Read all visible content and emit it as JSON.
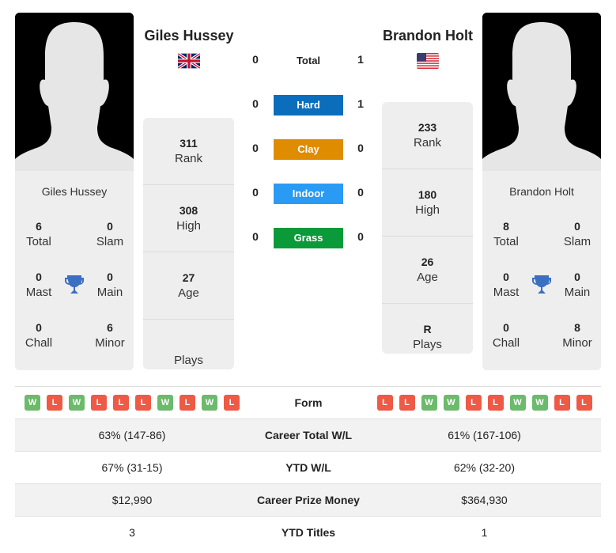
{
  "colors": {
    "hard": "#0a6ebd",
    "clay": "#df8c00",
    "indoor": "#2a9bf5",
    "grass": "#0b9a3a",
    "win": "#6cba6c",
    "loss": "#ee5a45",
    "trophy": "#3b6fc1"
  },
  "player1": {
    "name": "Giles Hussey",
    "flag": "gb-flag-icon",
    "titles": {
      "total": {
        "value": "6",
        "label": "Total"
      },
      "slam": {
        "value": "0",
        "label": "Slam"
      },
      "mast": {
        "value": "0",
        "label": "Mast"
      },
      "main": {
        "value": "0",
        "label": "Main"
      },
      "chall": {
        "value": "0",
        "label": "Chall"
      },
      "minor": {
        "value": "6",
        "label": "Minor"
      }
    },
    "stats": {
      "rank": {
        "value": "311",
        "label": "Rank"
      },
      "high": {
        "value": "308",
        "label": "High"
      },
      "age": {
        "value": "27",
        "label": "Age"
      },
      "plays": {
        "value": "",
        "label": "Plays"
      }
    }
  },
  "player2": {
    "name": "Brandon Holt",
    "flag": "us-flag-icon",
    "titles": {
      "total": {
        "value": "8",
        "label": "Total"
      },
      "slam": {
        "value": "0",
        "label": "Slam"
      },
      "mast": {
        "value": "0",
        "label": "Mast"
      },
      "main": {
        "value": "0",
        "label": "Main"
      },
      "chall": {
        "value": "0",
        "label": "Chall"
      },
      "minor": {
        "value": "8",
        "label": "Minor"
      }
    },
    "stats": {
      "rank": {
        "value": "233",
        "label": "Rank"
      },
      "high": {
        "value": "180",
        "label": "High"
      },
      "age": {
        "value": "26",
        "label": "Age"
      },
      "plays": {
        "value": "R",
        "label": "Plays"
      }
    }
  },
  "h2h": {
    "total": {
      "label": "Total",
      "p1": "0",
      "p2": "1"
    },
    "surfaces": [
      {
        "label": "Hard",
        "p1": "0",
        "p2": "1",
        "color": "#0a6ebd"
      },
      {
        "label": "Clay",
        "p1": "0",
        "p2": "0",
        "color": "#df8c00"
      },
      {
        "label": "Indoor",
        "p1": "0",
        "p2": "0",
        "color": "#2a9bf5"
      },
      {
        "label": "Grass",
        "p1": "0",
        "p2": "0",
        "color": "#0b9a3a"
      }
    ]
  },
  "comparison": {
    "form": {
      "label": "Form",
      "p1": [
        "W",
        "L",
        "W",
        "L",
        "L",
        "L",
        "W",
        "L",
        "W",
        "L"
      ],
      "p2": [
        "L",
        "L",
        "W",
        "W",
        "L",
        "L",
        "W",
        "W",
        "L",
        "L"
      ]
    },
    "rows": [
      {
        "label": "Career Total W/L",
        "p1": "63% (147-86)",
        "p2": "61% (167-106)"
      },
      {
        "label": "YTD W/L",
        "p1": "67% (31-15)",
        "p2": "62% (32-20)"
      },
      {
        "label": "Career Prize Money",
        "p1": "$12,990",
        "p2": "$364,930"
      },
      {
        "label": "YTD Titles",
        "p1": "3",
        "p2": "1"
      }
    ]
  }
}
